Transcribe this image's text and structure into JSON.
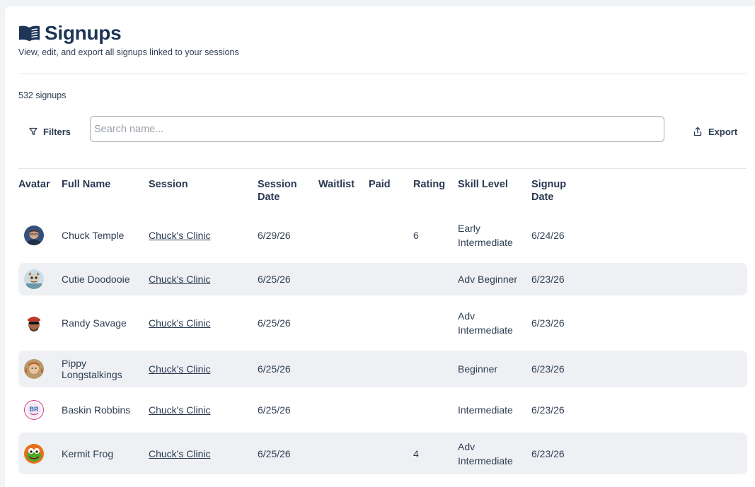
{
  "header": {
    "title": "Signups",
    "subtitle": "View, edit, and export all signups linked to your sessions"
  },
  "summary": {
    "count_text": "532 signups"
  },
  "toolbar": {
    "filters_label": "Filters",
    "search_placeholder": "Search name...",
    "search_value": "",
    "export_label": "Export"
  },
  "table": {
    "columns": {
      "avatar": "Avatar",
      "full_name": "Full Name",
      "session": "Session",
      "session_date_1": "Session",
      "session_date_2": "Date",
      "waitlist": "Waitlist",
      "paid": "Paid",
      "rating": "Rating",
      "skill_level": "Skill Level",
      "signup_date_1": "Signup",
      "signup_date_2": "Date"
    },
    "rows": [
      {
        "avatar": "man-with-glasses-avatar",
        "name": "Chuck Temple",
        "session": "Chuck's Clinic",
        "session_date": "6/29/26",
        "waitlist": "",
        "paid": "",
        "rating": "6",
        "skill_1": "Early",
        "skill_2": "Intermediate",
        "signup_date": "6/24/26"
      },
      {
        "avatar": "cartoon-character-avatar",
        "name": "Cutie Doodooie",
        "session": "Chuck's Clinic",
        "session_date": "6/25/26",
        "waitlist": "",
        "paid": "",
        "rating": "",
        "skill_1": "Adv Beginner",
        "skill_2": "",
        "signup_date": "6/23/26"
      },
      {
        "avatar": "wrestler-with-sunglasses-avatar",
        "name": "Randy Savage",
        "session": "Chuck's Clinic",
        "session_date": "6/25/26",
        "waitlist": "",
        "paid": "",
        "rating": "",
        "skill_1": "Adv",
        "skill_2": "Intermediate",
        "signup_date": "6/23/26"
      },
      {
        "avatar": "girl-with-braids-avatar",
        "name_1": "Pippy",
        "name_2": "Longstalkings",
        "session": "Chuck's Clinic",
        "session_date": "6/25/26",
        "waitlist": "",
        "paid": "",
        "rating": "",
        "skill_1": "Beginner",
        "skill_2": "",
        "signup_date": "6/23/26"
      },
      {
        "avatar": "br-logo-avatar",
        "avatar_text": "BR",
        "name": "Baskin Robbins",
        "session": "Chuck's Clinic",
        "session_date": "6/25/26",
        "waitlist": "",
        "paid": "",
        "rating": "",
        "skill_1": "Intermediate",
        "skill_2": "",
        "signup_date": "6/23/26"
      },
      {
        "avatar": "frog-puppet-avatar",
        "name": "Kermit Frog",
        "session": "Chuck's Clinic",
        "session_date": "6/25/26",
        "waitlist": "",
        "paid": "",
        "rating": "4",
        "skill_1": "Adv",
        "skill_2": "Intermediate",
        "signup_date": "6/23/26"
      }
    ]
  },
  "colors": {
    "title": "#1d3557",
    "row_alt": "#eef0f4",
    "divider": "#e3e6ea"
  }
}
